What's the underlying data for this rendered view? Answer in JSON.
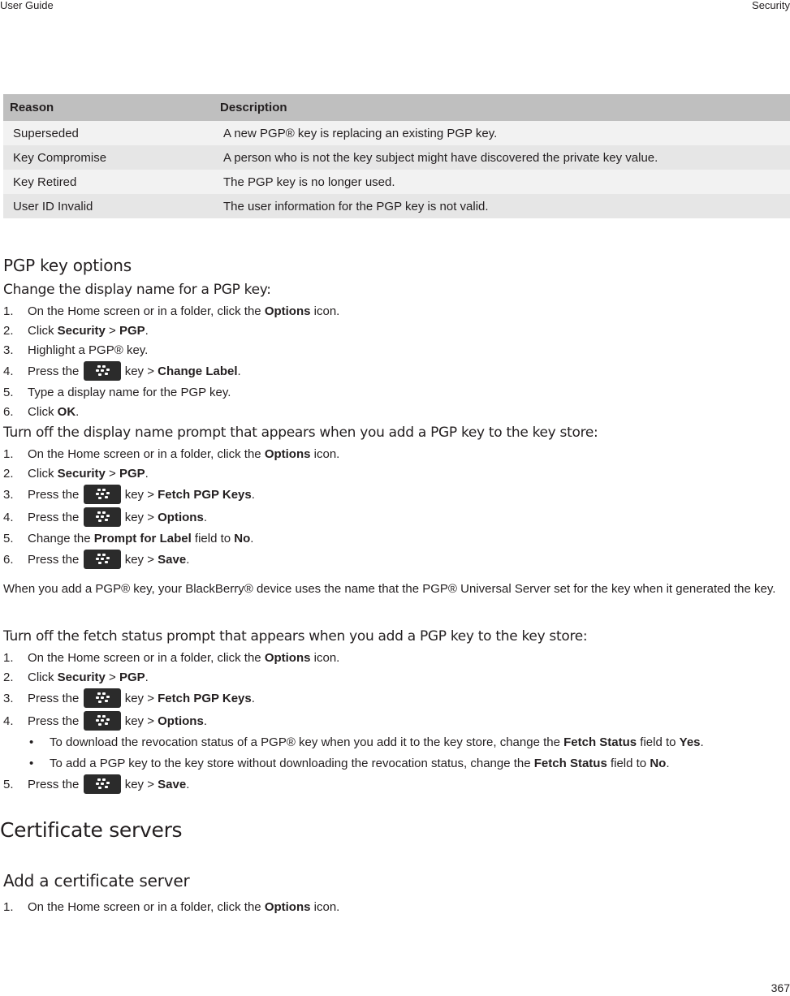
{
  "header": {
    "left": "User Guide",
    "right": "Security"
  },
  "footer": {
    "page_number": "367"
  },
  "reasons_table": {
    "columns": [
      "Reason",
      "Description"
    ],
    "rows": [
      [
        "Superseded",
        "A new PGP® key is replacing an existing PGP key."
      ],
      [
        "Key Compromise",
        "A person who is not the key subject might have discovered the private key value."
      ],
      [
        "Key Retired",
        "The PGP key is no longer used."
      ],
      [
        "User ID Invalid",
        "The user information for the PGP key is not valid."
      ]
    ]
  },
  "pgp_options": {
    "title": "PGP key options",
    "change_display_name": {
      "title": "Change the display name for a PGP key:",
      "steps": [
        {
          "num": "1.",
          "pre": "On the Home screen or in a folder, click the ",
          "bold": "Options",
          "post": " icon."
        },
        {
          "num": "2.",
          "pre": "Click ",
          "bold": "Security",
          "mid": " > ",
          "bold2": "PGP",
          "post": "."
        },
        {
          "num": "3.",
          "pre": "Highlight a PGP® key."
        },
        {
          "num": "4.",
          "pre": "Press the ",
          "key_icon": "blackberry-menu-key-icon",
          "mid": " key > ",
          "bold": "Change Label",
          "post": "."
        },
        {
          "num": "5.",
          "pre": "Type a display name for the PGP key."
        },
        {
          "num": "6.",
          "pre": "Click ",
          "bold": "OK",
          "post": "."
        }
      ]
    },
    "turn_off_display_prompt": {
      "title": "Turn off the display name prompt that appears when you add a PGP key to the key store:",
      "steps": [
        {
          "num": "1.",
          "pre": "On the Home screen or in a folder, click the ",
          "bold": "Options",
          "post": " icon."
        },
        {
          "num": "2.",
          "pre": "Click ",
          "bold": "Security",
          "mid": " > ",
          "bold2": "PGP",
          "post": "."
        },
        {
          "num": "3.",
          "pre": "Press the ",
          "mid": " key > ",
          "bold": "Fetch PGP Keys",
          "post": "."
        },
        {
          "num": "4.",
          "pre": "Press the ",
          "mid": " key > ",
          "bold": "Options",
          "post": "."
        },
        {
          "num": "5.",
          "pre": "Change the ",
          "bold": "Prompt for Label",
          "mid": " field to ",
          "bold2": "No",
          "post": "."
        },
        {
          "num": "6.",
          "pre": "Press the ",
          "mid": " key > ",
          "bold": "Save",
          "post": "."
        }
      ],
      "note": "When you add a PGP® key, your BlackBerry® device uses the name that the PGP® Universal Server set for the key when it generated the key."
    },
    "turn_off_fetch_prompt": {
      "title": "Turn off the fetch status prompt that appears when you add a PGP key to the key store:",
      "steps": [
        {
          "num": "1.",
          "pre": "On the Home screen or in a folder, click the ",
          "bold": "Options",
          "post": " icon."
        },
        {
          "num": "2.",
          "pre": "Click ",
          "bold": "Security",
          "mid": " > ",
          "bold2": "PGP",
          "post": "."
        },
        {
          "num": "3.",
          "pre": "Press the ",
          "mid": " key > ",
          "bold": "Fetch PGP Keys",
          "post": "."
        },
        {
          "num": "4.",
          "pre": "Press the ",
          "mid": " key > ",
          "bold": "Options",
          "post": "."
        },
        {
          "num": "5.",
          "pre": "Press the ",
          "mid": " key > ",
          "bold": "Save",
          "post": "."
        }
      ],
      "bullets": [
        {
          "pre": "To download the revocation status of a PGP® key when you add it to the key store, change the ",
          "bold": "Fetch Status",
          "mid": " field to ",
          "bold2": "Yes",
          "post": "."
        },
        {
          "pre": "To add a PGP key to the key store without downloading the revocation status, change the ",
          "bold": "Fetch Status",
          "mid": " field to ",
          "bold2": "No",
          "post": "."
        }
      ]
    }
  },
  "certificate_servers": {
    "title": "Certificate servers",
    "add_server": {
      "title": "Add a certificate server",
      "steps": [
        {
          "num": "1.",
          "pre": "On the Home screen or in a folder, click the ",
          "bold": "Options",
          "post": " icon."
        }
      ]
    }
  }
}
